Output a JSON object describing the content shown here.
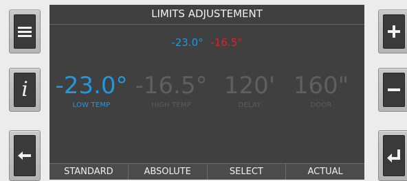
{
  "screen": {
    "title": "LIMITS ADJUSTEMENT",
    "summary": {
      "low": "-23.0°",
      "high": "-16.5°"
    },
    "params": [
      {
        "value": "-23.0°",
        "label": "LOW TEMP",
        "active": true
      },
      {
        "value": "-16.5°",
        "label": "HIGH TEMP",
        "active": false
      },
      {
        "value": "120'",
        "label": "DELAY",
        "active": false
      },
      {
        "value": "160\"",
        "label": "DOOR",
        "active": false
      }
    ],
    "softkeys": [
      "STANDARD",
      "ABSOLUTE",
      "SELECT",
      "ACTUAL"
    ]
  },
  "colors": {
    "accent": "#1f98e0",
    "alarm": "#d8262a",
    "screen_bg": "#404040"
  },
  "side_buttons": {
    "left": [
      "menu-icon",
      "info-icon",
      "back-arrow-icon"
    ],
    "right": [
      "plus-icon",
      "minus-icon",
      "enter-icon"
    ]
  }
}
